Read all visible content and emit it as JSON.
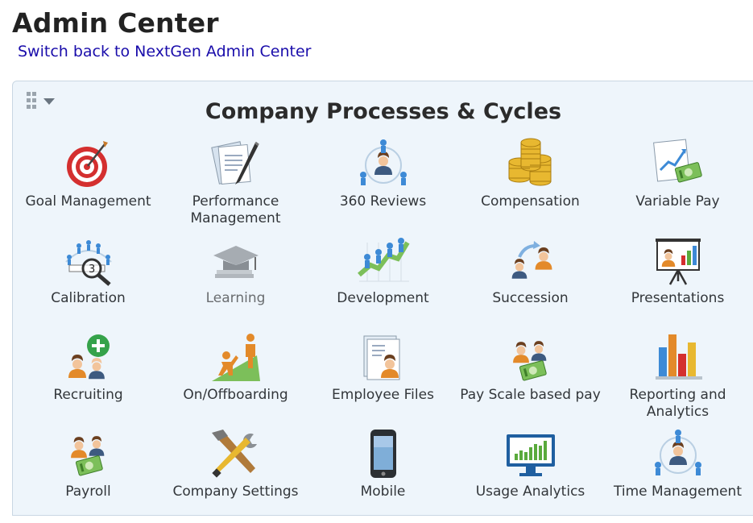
{
  "header": {
    "title": "Admin Center",
    "switch_link": "Switch back to NextGen Admin Center"
  },
  "panel": {
    "menu_icons": [
      "grid-icon",
      "caret-down-icon"
    ],
    "title": "Company Processes & Cycles",
    "tiles": [
      {
        "label": "Goal Management",
        "icon": "target-icon"
      },
      {
        "label": "Performance Management",
        "icon": "document-pen-icon"
      },
      {
        "label": "360 Reviews",
        "icon": "people-circle-icon"
      },
      {
        "label": "Compensation",
        "icon": "coins-icon"
      },
      {
        "label": "Variable Pay",
        "icon": "chart-money-icon"
      },
      {
        "label": "Calibration",
        "icon": "calibration-magnifier-icon"
      },
      {
        "label": "Learning",
        "icon": "graduation-cap-icon",
        "disabled": true
      },
      {
        "label": "Development",
        "icon": "growth-chart-icon"
      },
      {
        "label": "Succession",
        "icon": "succession-people-icon"
      },
      {
        "label": "Presentations",
        "icon": "presentation-board-icon"
      },
      {
        "label": "Recruiting",
        "icon": "add-people-icon"
      },
      {
        "label": "On/Offboarding",
        "icon": "climbing-people-icon"
      },
      {
        "label": "Employee Files",
        "icon": "employee-file-icon"
      },
      {
        "label": "Pay Scale based pay",
        "icon": "people-money-icon"
      },
      {
        "label": "Reporting and Analytics",
        "icon": "bar-chart-icon"
      },
      {
        "label": "Payroll",
        "icon": "payroll-icon"
      },
      {
        "label": "Company Settings",
        "icon": "tools-icon"
      },
      {
        "label": "Mobile",
        "icon": "mobile-phone-icon"
      },
      {
        "label": "Usage Analytics",
        "icon": "monitor-chart-icon"
      },
      {
        "label": "Time Management",
        "icon": "people-circle-icon"
      }
    ]
  },
  "colors": {
    "panel_bg": "#eef5fb",
    "link": "#1a0dab",
    "accent_blue": "#3d8ad6",
    "accent_orange": "#e38a2a",
    "accent_green": "#5aaa3c",
    "accent_red": "#d23a3a"
  }
}
